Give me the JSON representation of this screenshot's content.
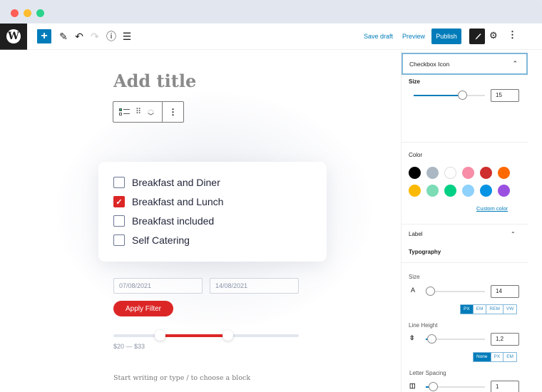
{
  "window": {
    "controls": [
      "close",
      "minimize",
      "maximize"
    ]
  },
  "toolbar": {
    "logo_glyph": "W",
    "add_label": "+",
    "tools_icon": "✎",
    "undo_icon": "↶",
    "redo_icon": "↷",
    "info_icon": "ⓘ",
    "list_view_icon": "☰",
    "save_draft": "Save draft",
    "preview": "Preview",
    "publish": "Publish",
    "settings_icon": "⚙",
    "more_icon": "⋮",
    "brush_icon": "🖌"
  },
  "editor": {
    "title_placeholder": "Add title",
    "block_toolbar": {
      "drag_icon": "⠿",
      "up_icon": "︿",
      "down_icon": "﹀",
      "more_icon": "⋮"
    },
    "checkbox_items": [
      {
        "label": "Breakfast and Diner",
        "checked": false
      },
      {
        "label": "Breakfast and Lunch",
        "checked": true
      },
      {
        "label": "Breakfast included",
        "checked": false
      },
      {
        "label": "Self Catering",
        "checked": false
      }
    ],
    "check_glyph": "✓",
    "date_from": "07/08/2021",
    "date_to": "14/08/2021",
    "apply_filter": "Apply Filter",
    "price_range": {
      "min": 20,
      "max": 33,
      "label": "$20 — $33",
      "low_fraction": 0.25,
      "high_fraction": 0.615
    },
    "block_placeholder": "Start writing or type / to choose a block"
  },
  "sidebar": {
    "checkbox_icon_panel": {
      "title": "Checkbox Icon",
      "chevron": "⌃",
      "size_label": "Size",
      "size_value": "15",
      "size_fraction": 0.68
    },
    "color": {
      "label": "Color",
      "swatches": [
        "#000000",
        "#abb8c3",
        "#ffffff",
        "#f78da7",
        "#cf2e2e",
        "#ff6900",
        "#fcb900",
        "#7bdcb5",
        "#00d084",
        "#8ed1fc",
        "#0693e3",
        "#9b51e0"
      ],
      "custom_color": "Custom color"
    },
    "label_panel": {
      "title": "Label",
      "chevron": "⌃",
      "typography": "Typography",
      "size_label": "Size",
      "size_icon": "A",
      "size_value": "14",
      "size_units": [
        "PX",
        "EM",
        "REM",
        "VW"
      ],
      "size_unit_active": "PX",
      "line_height_label": "Line Height",
      "line_height_icon": "⇳",
      "line_height_value": "1,2",
      "line_height_units": [
        "None",
        "PX",
        "EM"
      ],
      "line_height_unit_active": "None",
      "letter_spacing_label": "Letter Spacing",
      "letter_spacing_icon": "◫",
      "letter_spacing_value": "1"
    }
  }
}
